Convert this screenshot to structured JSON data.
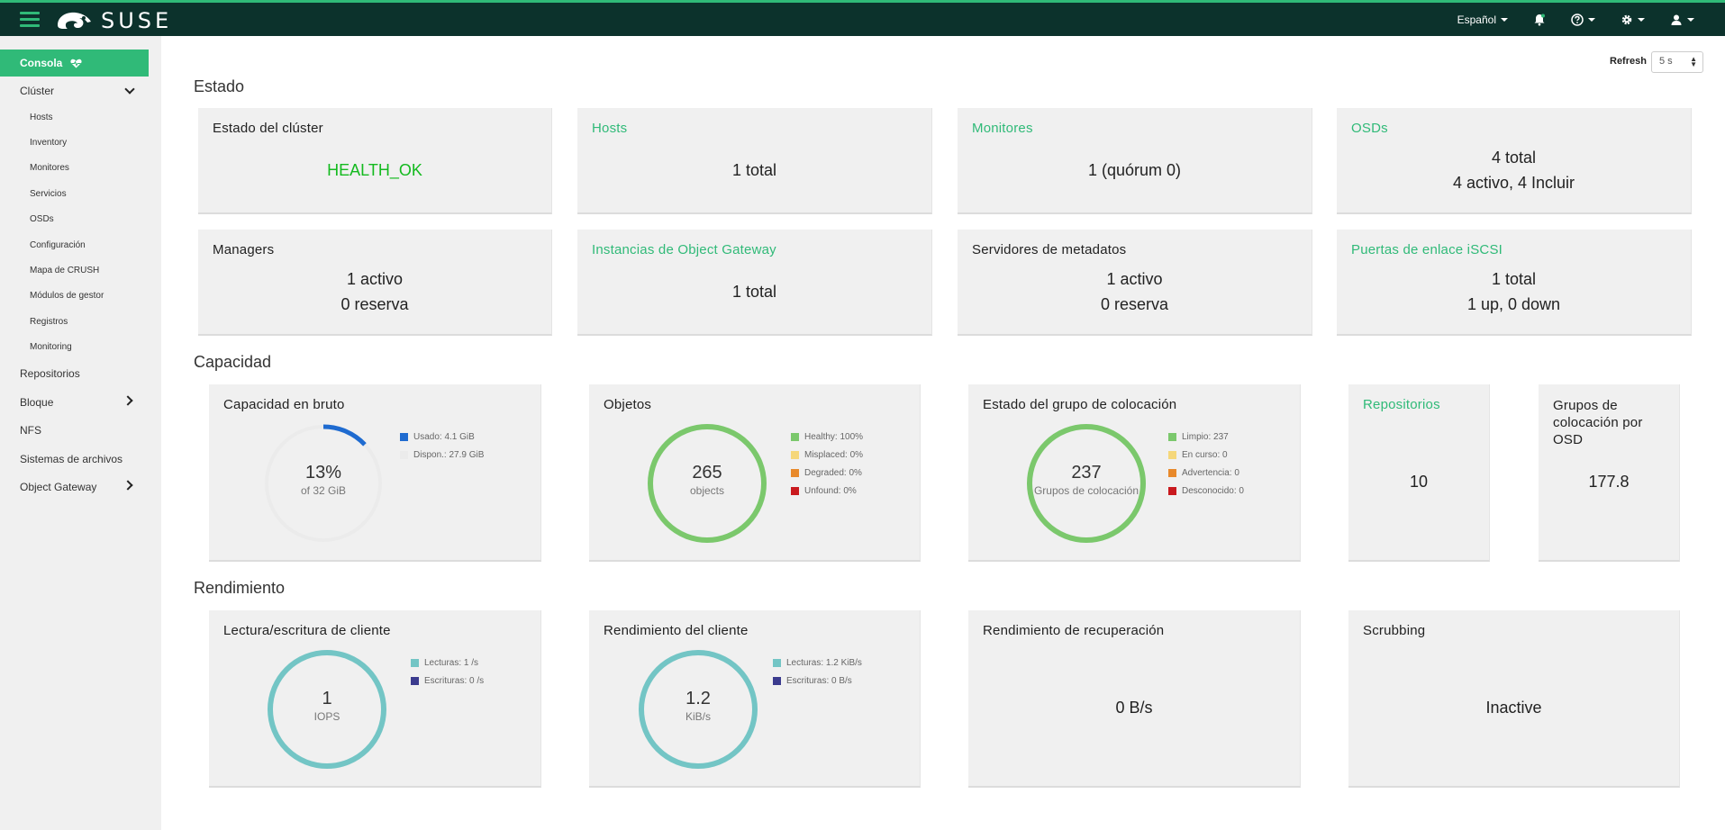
{
  "app": {
    "brand": "SUSE",
    "language": "Español"
  },
  "colors": {
    "accent": "#30ba78",
    "nav_bg": "#0c322c",
    "health_ok": "#14ba1f",
    "ring_green": "#7bc86c",
    "ring_teal": "#73c5c5",
    "used_blue": "#1f6bd0",
    "free_grey": "#ebebeb"
  },
  "sidebar": {
    "active": "Consola",
    "cluster": "Clúster",
    "cluster_items": [
      "Hosts",
      "Inventory",
      "Monitores",
      "Servicios",
      "OSDs",
      "Configuración",
      "Mapa de CRUSH",
      "Módulos de gestor",
      "Registros",
      "Monitoring"
    ],
    "repos": "Repositorios",
    "block": "Bloque",
    "nfs": "NFS",
    "filesystems": "Sistemas de archivos",
    "object_gateway": "Object Gateway"
  },
  "refresh": {
    "label": "Refresh",
    "value": "5 s"
  },
  "sections": {
    "status": "Estado",
    "capacity": "Capacidad",
    "performance": "Rendimiento"
  },
  "status_cards": {
    "cluster_health": {
      "title": "Estado del clúster",
      "value": "HEALTH_OK"
    },
    "hosts": {
      "title": "Hosts",
      "value": "1 total"
    },
    "monitors": {
      "title": "Monitores",
      "value": "1 (quórum 0)"
    },
    "osds": {
      "title": "OSDs",
      "line1": "4 total",
      "line2": "4 activo, 4 Incluir"
    },
    "managers": {
      "title": "Managers",
      "line1": "1 activo",
      "line2": "0 reserva"
    },
    "rgw": {
      "title": "Instancias de Object Gateway",
      "value": "1 total"
    },
    "mds": {
      "title": "Servidores de metadatos",
      "line1": "1 activo",
      "line2": "0 reserva"
    },
    "iscsi": {
      "title": "Puertas de enlace iSCSI",
      "line1": "1 total",
      "line2": "1 up, 0 down"
    }
  },
  "capacity_cards": {
    "raw": {
      "title": "Capacidad en bruto",
      "percent": "13%",
      "sub": "of 32 GiB",
      "used_fraction": 0.13,
      "legend": [
        "Usado: 4.1 GiB",
        "Dispon.: 27.9 GiB"
      ]
    },
    "objects": {
      "title": "Objetos",
      "count": "265",
      "sub": "objects",
      "legend": [
        "Healthy: 100%",
        "Misplaced: 0%",
        "Degraded: 0%",
        "Unfound: 0%"
      ]
    },
    "pg_status": {
      "title": "Estado del grupo de colocación",
      "count": "237",
      "sub": "Grupos de colocación",
      "legend": [
        "Limpio: 237",
        "En curso: 0",
        "Advertencia: 0",
        "Desconocido: 0"
      ]
    },
    "pools": {
      "title": "Repositorios",
      "value": "10"
    },
    "pgs_per_osd": {
      "title": "Grupos de colocación por OSD",
      "value": "177.8"
    }
  },
  "performance_cards": {
    "client_rw": {
      "title": "Lectura/escritura de cliente",
      "value": "1",
      "sub": "IOPS",
      "legend": [
        "Lecturas: 1 /s",
        "Escrituras: 0 /s"
      ]
    },
    "client_throughput": {
      "title": "Rendimiento del cliente",
      "value": "1.2",
      "sub": "KiB/s",
      "legend": [
        "Lecturas: 1.2 KiB/s",
        "Escrituras: 0 B/s"
      ]
    },
    "recovery": {
      "title": "Rendimiento de recuperación",
      "value": "0 B/s"
    },
    "scrubbing": {
      "title": "Scrubbing",
      "value": "Inactive"
    }
  },
  "legend_colors": {
    "raw": [
      "#1f6bd0",
      "#ebebeb"
    ],
    "objects": [
      "#7bc86c",
      "#f5d77a",
      "#e8892b",
      "#c9191e"
    ],
    "pg": [
      "#7bc86c",
      "#f5d77a",
      "#e8892b",
      "#c9191e"
    ],
    "perf": [
      "#73c5c5",
      "#3b3b8e"
    ]
  },
  "icons": {
    "menu": "hamburger-icon",
    "logo": "chameleon-icon",
    "notifications": "bell-icon",
    "help": "question-icon",
    "settings": "gear-icon",
    "user": "user-icon",
    "dashboard": "heartbeat-icon"
  }
}
